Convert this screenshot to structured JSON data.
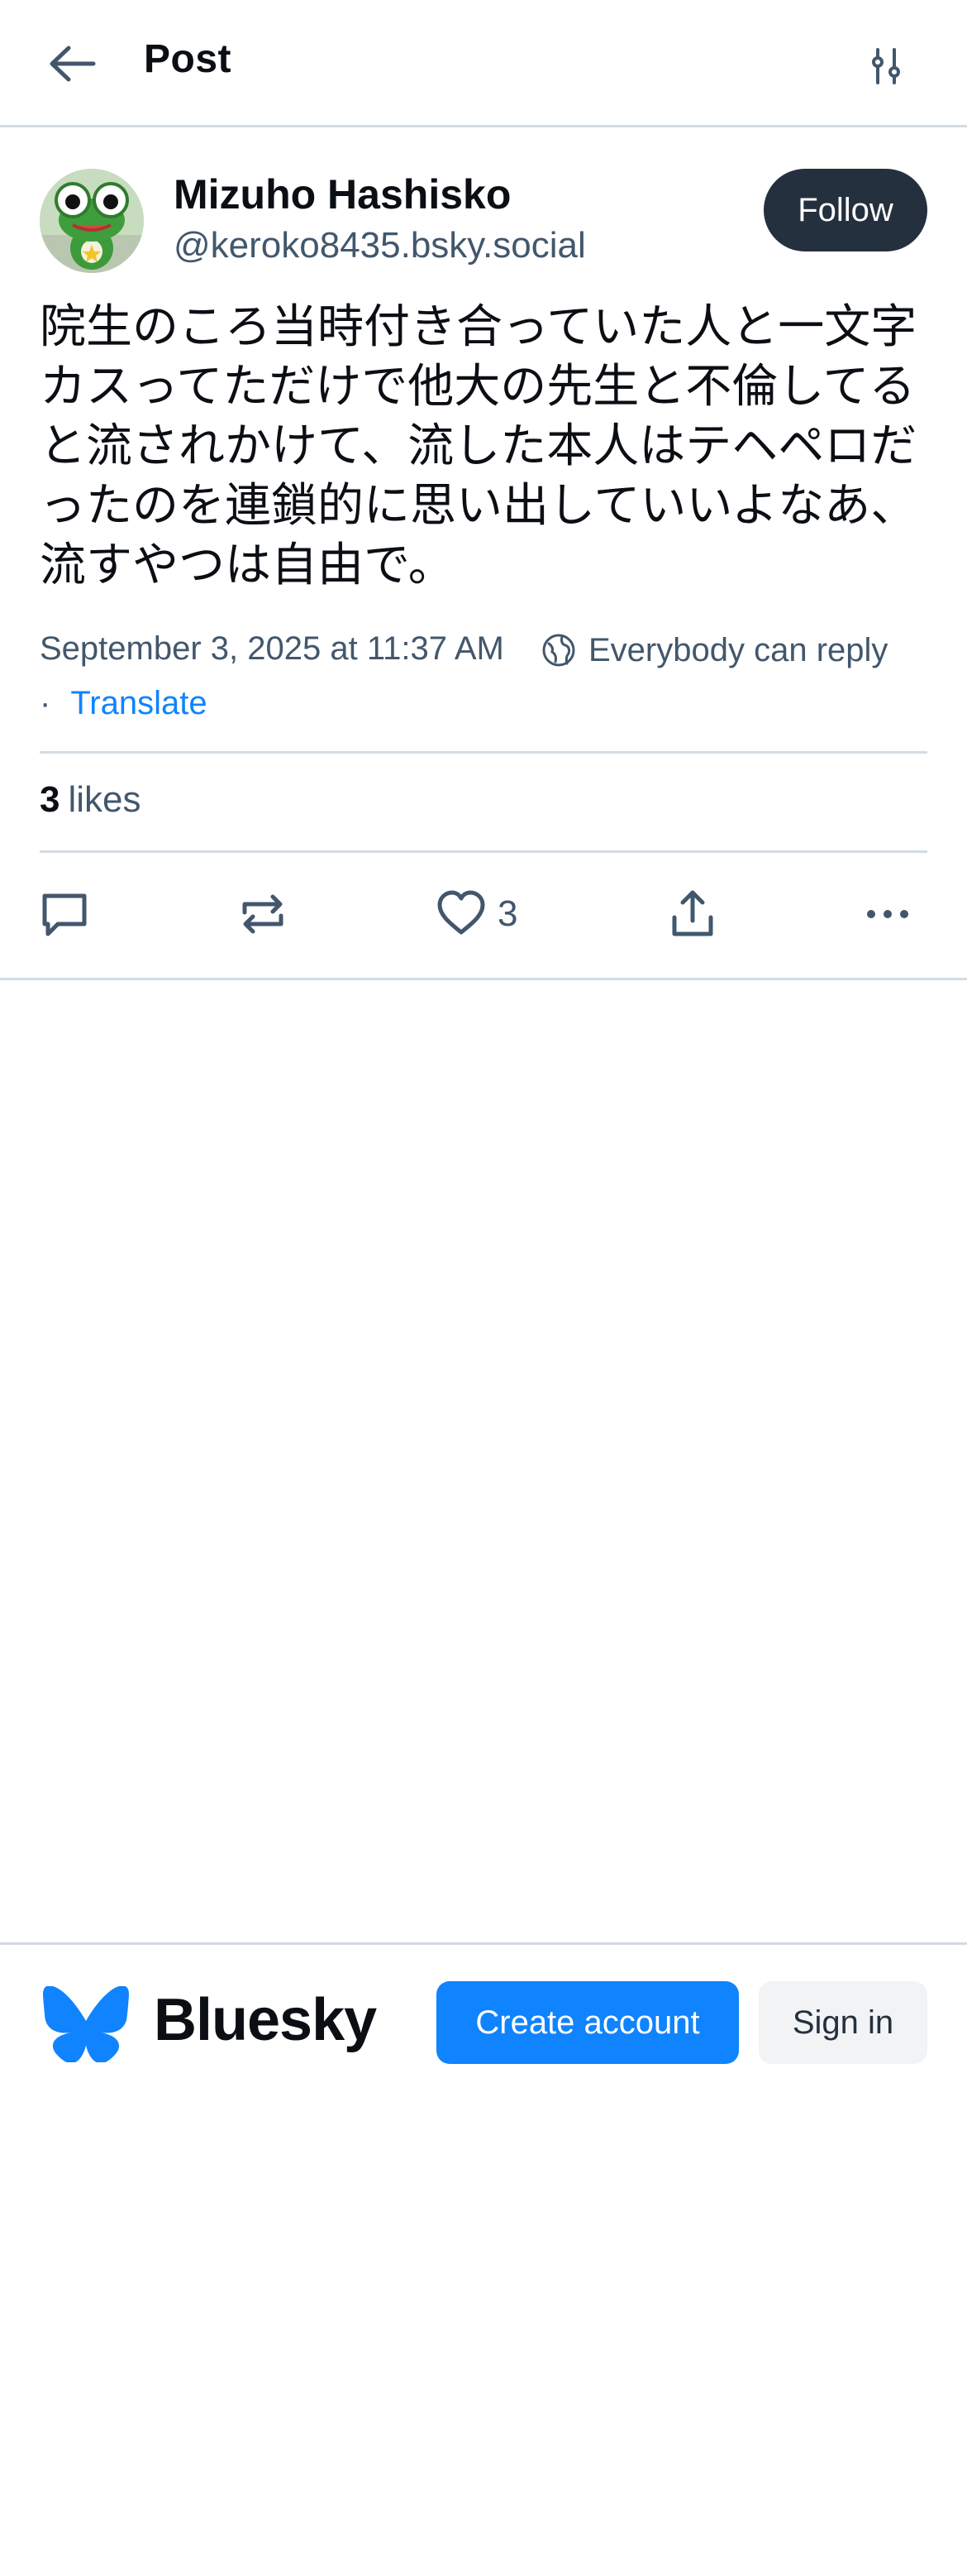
{
  "header": {
    "title": "Post",
    "back_icon": "arrow-left-icon",
    "filter_icon": "sliders-icon"
  },
  "post": {
    "author": {
      "display_name": "Mizuho Hashisko",
      "handle": "@keroko8435.bsky.social",
      "follow_label": "Follow"
    },
    "text_lines": [
      "院生のころ当時付き合っていた人と一文字",
      "カスってただけで他大の先生と不倫してる",
      "と流されかけて、流した本人はテヘペロだ",
      "ったのを連鎖的に思い出していいよなあ、",
      "流すやつは自由で。"
    ],
    "timestamp": "September 3, 2025 at 11:37 AM",
    "reply_setting": "Everybody can reply",
    "separator": "·",
    "translate_label": "Translate",
    "likes_count": "3",
    "likes_label": "likes",
    "like_button_count": "3"
  },
  "footer": {
    "brand": "Bluesky",
    "create_account_label": "Create account",
    "sign_in_label": "Sign in"
  },
  "colors": {
    "accent": "#1083fe",
    "follow_bg": "#25303e",
    "muted_text": "#42576c",
    "divider": "#d4dbe2"
  }
}
